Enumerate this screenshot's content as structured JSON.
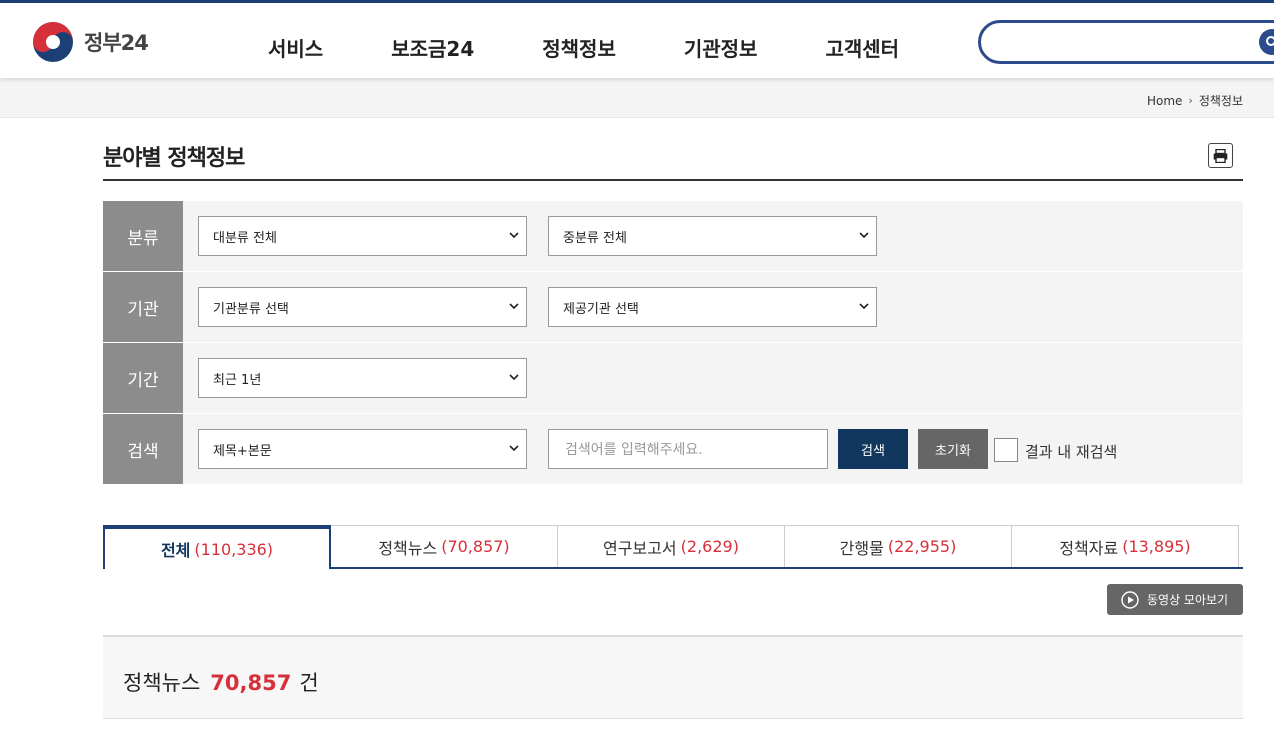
{
  "header": {
    "logo_text": "정부24",
    "nav": [
      "서비스",
      "보조금24",
      "정책정보",
      "기관정보",
      "고객센터"
    ]
  },
  "breadcrumb": [
    "Home",
    "정책정보"
  ],
  "page": {
    "title": "분야별 정책정보"
  },
  "filters": {
    "category": {
      "label": "분류",
      "major": "대분류 전체",
      "minor": "중분류 전체"
    },
    "agency": {
      "label": "기관",
      "type": "기관분류 선택",
      "provider": "제공기관 선택"
    },
    "period": {
      "label": "기간",
      "value": "최근 1년"
    },
    "search": {
      "label": "검색",
      "scope": "제목+본문",
      "placeholder": "검색어를 입력해주세요.",
      "search_button": "검색",
      "reset_button": "초기화",
      "research_label": "결과 내 재검색"
    }
  },
  "tabs": [
    {
      "label": "전체",
      "count": "(110,336)"
    },
    {
      "label": "정책뉴스",
      "count": "(70,857)"
    },
    {
      "label": "연구보고서",
      "count": "(2,629)"
    },
    {
      "label": "간행물",
      "count": "(22,955)"
    },
    {
      "label": "정책자료",
      "count": "(13,895)"
    }
  ],
  "video_button": "동영상 모아보기",
  "result": {
    "category": "정책뉴스",
    "count": "70,857",
    "unit": "건"
  },
  "colors": {
    "brand": "#1c3f75",
    "accent_red": "#d6313a",
    "label_bg": "#8c8c8c"
  }
}
